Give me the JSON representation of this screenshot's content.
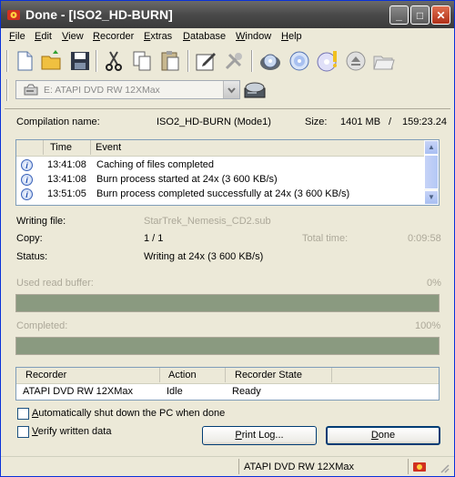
{
  "window": {
    "title": "Done - [ISO2_HD-BURN]"
  },
  "title_buttons": {
    "minimize": "_",
    "maximize": "□",
    "close": "✕"
  },
  "menu": [
    {
      "label": "File",
      "accel": "F",
      "rest": "ile"
    },
    {
      "label": "Edit",
      "accel": "E",
      "rest": "dit"
    },
    {
      "label": "View",
      "accel": "V",
      "rest": "iew"
    },
    {
      "label": "Recorder",
      "accel": "R",
      "rest": "ecorder"
    },
    {
      "label": "Extras",
      "accel": "E",
      "rest": "xtras"
    },
    {
      "label": "Database",
      "accel": "D",
      "rest": "atabase"
    },
    {
      "label": "Window",
      "accel": "W",
      "rest": "indow"
    },
    {
      "label": "Help",
      "accel": "H",
      "rest": "elp"
    }
  ],
  "toolbar_icons": [
    "new-document-icon",
    "open-folder-icon",
    "save-icon",
    "cut-icon",
    "copy-icon",
    "paste-icon",
    "edit-compilation-icon",
    "burn-disabled-icon",
    "copy-disc-icon",
    "disc-icon",
    "disc-info-icon",
    "eject-icon",
    "open-folder-disabled-icon"
  ],
  "drive": {
    "selected": "E: ATAPI   DVD RW 12XMax"
  },
  "compilation": {
    "name_label": "Compilation name:",
    "name_value": "ISO2_HD-BURN (Mode1)",
    "size_label": "Size:",
    "size_value": "1401 MB",
    "separator": "/",
    "duration": "159:23.24"
  },
  "log": {
    "columns": [
      "Time",
      "Event"
    ],
    "rows": [
      {
        "time": "13:41:08",
        "event": "Caching of files completed"
      },
      {
        "time": "13:41:08",
        "event": "Burn process started at 24x (3 600 KB/s)"
      },
      {
        "time": "13:51:05",
        "event": "Burn process completed successfully at 24x (3 600 KB/s)"
      }
    ]
  },
  "details": {
    "writing_file_label": "Writing file:",
    "writing_file_value": "StarTrek_Nemesis_CD2.sub",
    "copy_label": "Copy:",
    "copy_value": "1 / 1",
    "total_time_label": "Total time:",
    "total_time_value": "0:09:58",
    "status_label": "Status:",
    "status_value": "Writing at 24x (3 600 KB/s)"
  },
  "buffer": {
    "label": "Used read buffer:",
    "percent_text": "0%",
    "fraction": 0
  },
  "completed": {
    "label": "Completed:",
    "percent_text": "100%",
    "fraction": 1
  },
  "recorders": {
    "columns": [
      "Recorder",
      "Action",
      "Recorder State"
    ],
    "rows": [
      {
        "recorder": "ATAPI DVD RW 12XMax",
        "action": "Idle",
        "state": "Ready"
      }
    ]
  },
  "options": {
    "shutdown_label": "Automatically shut down the PC when done",
    "shutdown_accel": "A",
    "shutdown_rest": "utomatically shut down the PC when done",
    "verify_label": "Verify written data",
    "verify_accel": "V",
    "verify_rest": "erify written data"
  },
  "buttons": {
    "print_log": "Print Log...",
    "print_accel": "P",
    "print_rest": "rint Log...",
    "done": "Done",
    "done_accel": "D",
    "done_rest": "one"
  },
  "statusbar": {
    "text": "ATAPI   DVD RW 12XMax"
  },
  "colors": {
    "progress_fill": "#8a9a80",
    "title_bar": "#4a4a4a",
    "info_icon": "#1a4bb0"
  }
}
